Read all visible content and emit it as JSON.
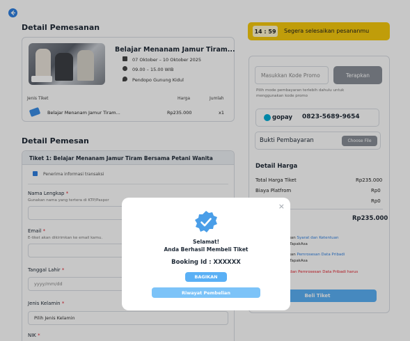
{
  "header": {
    "back_label": ""
  },
  "order_detail": {
    "title": "Detail Pemesanan",
    "event_title": "Belajar Menanam Jamur Tiram...",
    "date": "07 Oktober – 10 Oktober 2025",
    "time": "09.00 – 15.00 WIB",
    "location": "Pendopo Gunung Kidul",
    "col_ticket": "Jenis Tiket",
    "col_price": "Harga",
    "col_qty": "Jumlah",
    "row_name": "Belajar Menanam Jamur Tiram...",
    "row_price": "Rp235.000",
    "row_qty": "x1"
  },
  "buyer": {
    "title": "Detail Pemesan",
    "ticket_header": "Tiket 1: Belajar Menanam Jamur Tiram Bersama Petani Wanita",
    "info_check": "Penerima informasi transaksi",
    "name_label": "Nama Lengkap",
    "name_help": "Gunakan nama yang tertera di KTP/Paspor",
    "email_label": "Email",
    "email_help": "E-tiket akan dikirimkan ke email kamu.",
    "dob_label": "Tanggal Lahir",
    "dob_placeholder": "yyyy/mm/dd",
    "gender_label": "Jenis Kelamin",
    "gender_value": "Pilih Jenis Kelamin",
    "nik_label": "NIK",
    "required_mark": "*"
  },
  "timer": {
    "time": "14 : 59",
    "message": "Segera selesaikan pesananmu"
  },
  "payment": {
    "promo_placeholder": "Masukkan Kode Promo",
    "promo_button": "Terapkan",
    "promo_help_1": "Pilih mode pembayaran terlebih dahulu untuk",
    "promo_help_2": "menggunakan kode promo",
    "gopay_brand": "gopay",
    "gopay_number": "0823-5689-9654",
    "proof_label": "Bukti Pembayaran",
    "choose_file": "Choose File",
    "price_title": "Detail Harga",
    "total_ticket_label": "Total Harga Tiket",
    "total_ticket_value": "Rp235.000",
    "platform_label": "Biaya Platfrom",
    "platform_value": "Rp0",
    "other_value": "Rp0",
    "grand_total": "Rp235.000",
    "terms_1a": "dengan ",
    "terms_1b": "Syarat dan Ketentuan",
    "terms_1c": "u di TapakAsa",
    "terms_2a": "dengan ",
    "terms_2b": "Pemrosesan Data Pribadi",
    "terms_2c": "u di TapakAsa",
    "terms_3": "uan dan Pemrosesan Data Pribadi harus",
    "buy_button": "Beli Tiket"
  },
  "modal": {
    "close": "×",
    "line1": "Selamat!",
    "line2": "Anda Berhasil Membeli Tiket",
    "booking": "Booking Id : XXXXXX",
    "share_button": "BAGIKAN",
    "history_button": "Riwayat Pembelian"
  },
  "colors": {
    "accent": "#2f7fe0",
    "timer": "#f6c90e",
    "modal_button": "#5ab0f5"
  }
}
